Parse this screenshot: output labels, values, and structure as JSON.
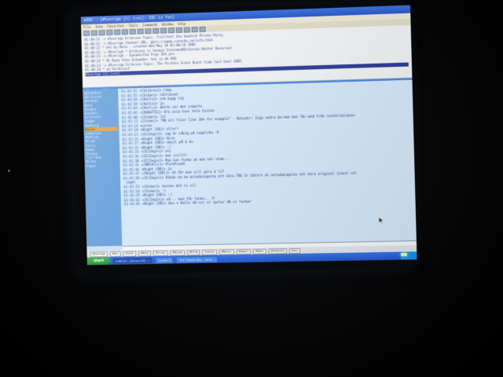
{
  "window": {
    "title": "mIRC - [#Sverige [1] [+nt]: IRC is fun]",
    "menu": [
      "File",
      "View",
      "Favorites",
      "Tools",
      "Commands",
      "Window",
      "Help"
    ]
  },
  "status_pane": {
    "lines": [
      "01:40:21 -> #Sverige Eriksson Topic: Trollfest the Swedish Pirate Party.",
      "01:40:21 -> #Sverige Channel URL: gbrn://wmmq.svenska.se/info.html",
      "01:40:22 * Set by Beta - created Wed May 28 01:00:26 2003",
      "01:40:22 -> #Sverige * Eriksson is Snoopz.Intermed#Eriksson Nutter Reversed",
      "01:40:23 -> #Sverige - DynamicFaa Pryp 3b4 yes",
      "01:40:23 * Rt Ryan Sten Schweden: kan ju de  KKO",
      "01:40:23 -> #Sverige Eriksson Topic: The Pirates Scene Quest time  last hour 2003",
      "01:40:24 * wo bordurpst"
    ],
    "highlight_line": "#Sverige [1] [+nt]"
  },
  "channel_title": "#Sverige [17] [+nt]: Info lite Svensk chat :: Gruppen Fortkörning www.gruppen.se",
  "nicklist": [
    "@ChanServ",
    "@Eriksson",
    "@Snoopz",
    "Beta",
    "Dragon",
    "Dynamic",
    "Eriksson",
    "Gugge",
    "Hamburg",
    "Kalle",
    "Lamarian",
    "Mattias",
    "Nicke",
    "Pelle",
    "Reder",
    "Snoopy",
    "Trollbon",
    "Wilma",
    "Yngve"
  ],
  "selected_nick_index": 9,
  "messages": [
    {
      "ts": "01:44:55",
      "text": "<[Stjärna]> lämp"
    },
    {
      "ts": "01:44:55",
      "text": "<[Simon]> rättiksed"
    },
    {
      "ts": "01:44:58",
      "text": "<[Hulla]> som bygg sig"
    },
    {
      "ts": "01:44:59",
      "text": "<[Holla]> ja"
    },
    {
      "ts": "01:45:02",
      "text": "<[Hollu]> detta var det inmarta"
    },
    {
      "ts": "01:45:05",
      "text": "<[RABATTE]> Dra ovia över hele hyssan"
    },
    {
      "ts": "01:45:08",
      "text": "<[Simon]> lol"
    },
    {
      "ts": "01:45:11",
      "text": "<[Simon]> \"MD all filer like 10% for example\" - Botyder: Inga andra än hem man fås med från installationer"
    },
    {
      "ts": "01:45:14",
      "text": "nuvras"
    },
    {
      "ts": "01:45:18",
      "text": "<Night [DB]> eller?"
    },
    {
      "ts": "01:45:21",
      "text": "<[E]Zegin]> jag är säkig på cogelika -D"
    },
    {
      "ts": "01:45:24",
      "text": "<Night [DB]> Nice"
    },
    {
      "ts": "01:45:27",
      "text": "<Night [DB]> okyil på d do"
    },
    {
      "ts": "01:45:31",
      "text": "<Night [DB]> :)"
    },
    {
      "ts": "01:45:33",
      "text": "<[E]Zegin]> nej"
    },
    {
      "ts": "01:45:36",
      "text": "<[E]Zegin]> men svillt!"
    },
    {
      "ts": "01:45:38",
      "text": "<[E]Zegin]> Man kan funka om man kör utom..."
    },
    {
      "ts": "01:45:41",
      "text": "<[NM]Allil> #lol#leadl"
    },
    {
      "ts": "01:45:44",
      "text": "<Night [DB]> ja"
    },
    {
      "ts": "01:45:47",
      "text": "<[Night [DB]]> nå får man vill göra d lif"
    },
    {
      "ts": "01:45:50",
      "text": "<[E]Zegin]> Kände om om anledningarna att köra TNG är bättre än anledningarna att köra original (Läser vel"
    },
    {
      "ts": "",
      "text": "inge)"
    },
    {
      "ts": "01:45:53",
      "text": "<[Simon]> kanske det ni vil"
    },
    {
      "ts": "01:45:56",
      "text": "<[Simon]> :)"
    },
    {
      "ts": "01:45:59",
      "text": "<Night [DB]> :)"
    },
    {
      "ts": "01:46:02",
      "text": "<[E]Zegin]> vå... men får funka.. :P"
    },
    {
      "ts": "01:46:05",
      "text": "<Night [DB]> Hon e Bolle då oss vi spelar UB vi funkar"
    }
  ],
  "switchbar": [
    "#Sverige",
    "#Kul",
    "#Inet",
    "#Help",
    "#Linux",
    "#Muzak",
    "#Film",
    "Status",
    "#Music",
    "#Sport",
    "#Spel",
    "#Svenska",
    "Quiz"
  ],
  "taskbar": {
    "start_label": "start",
    "tasks": [
      "mIRC32 - [Forum IRC ...",
      "Quake 3",
      "The Pirates Bay - Ame..."
    ],
    "active_task_index": 0
  },
  "colors": {
    "titlebar": "#3a6fd2",
    "nicklist_bg": "#6b9fd4",
    "messages_bg": "#d4e7f6",
    "message_text": "#1f3a78",
    "taskbar": "#2556c2",
    "start_button": "#2d8a33"
  }
}
